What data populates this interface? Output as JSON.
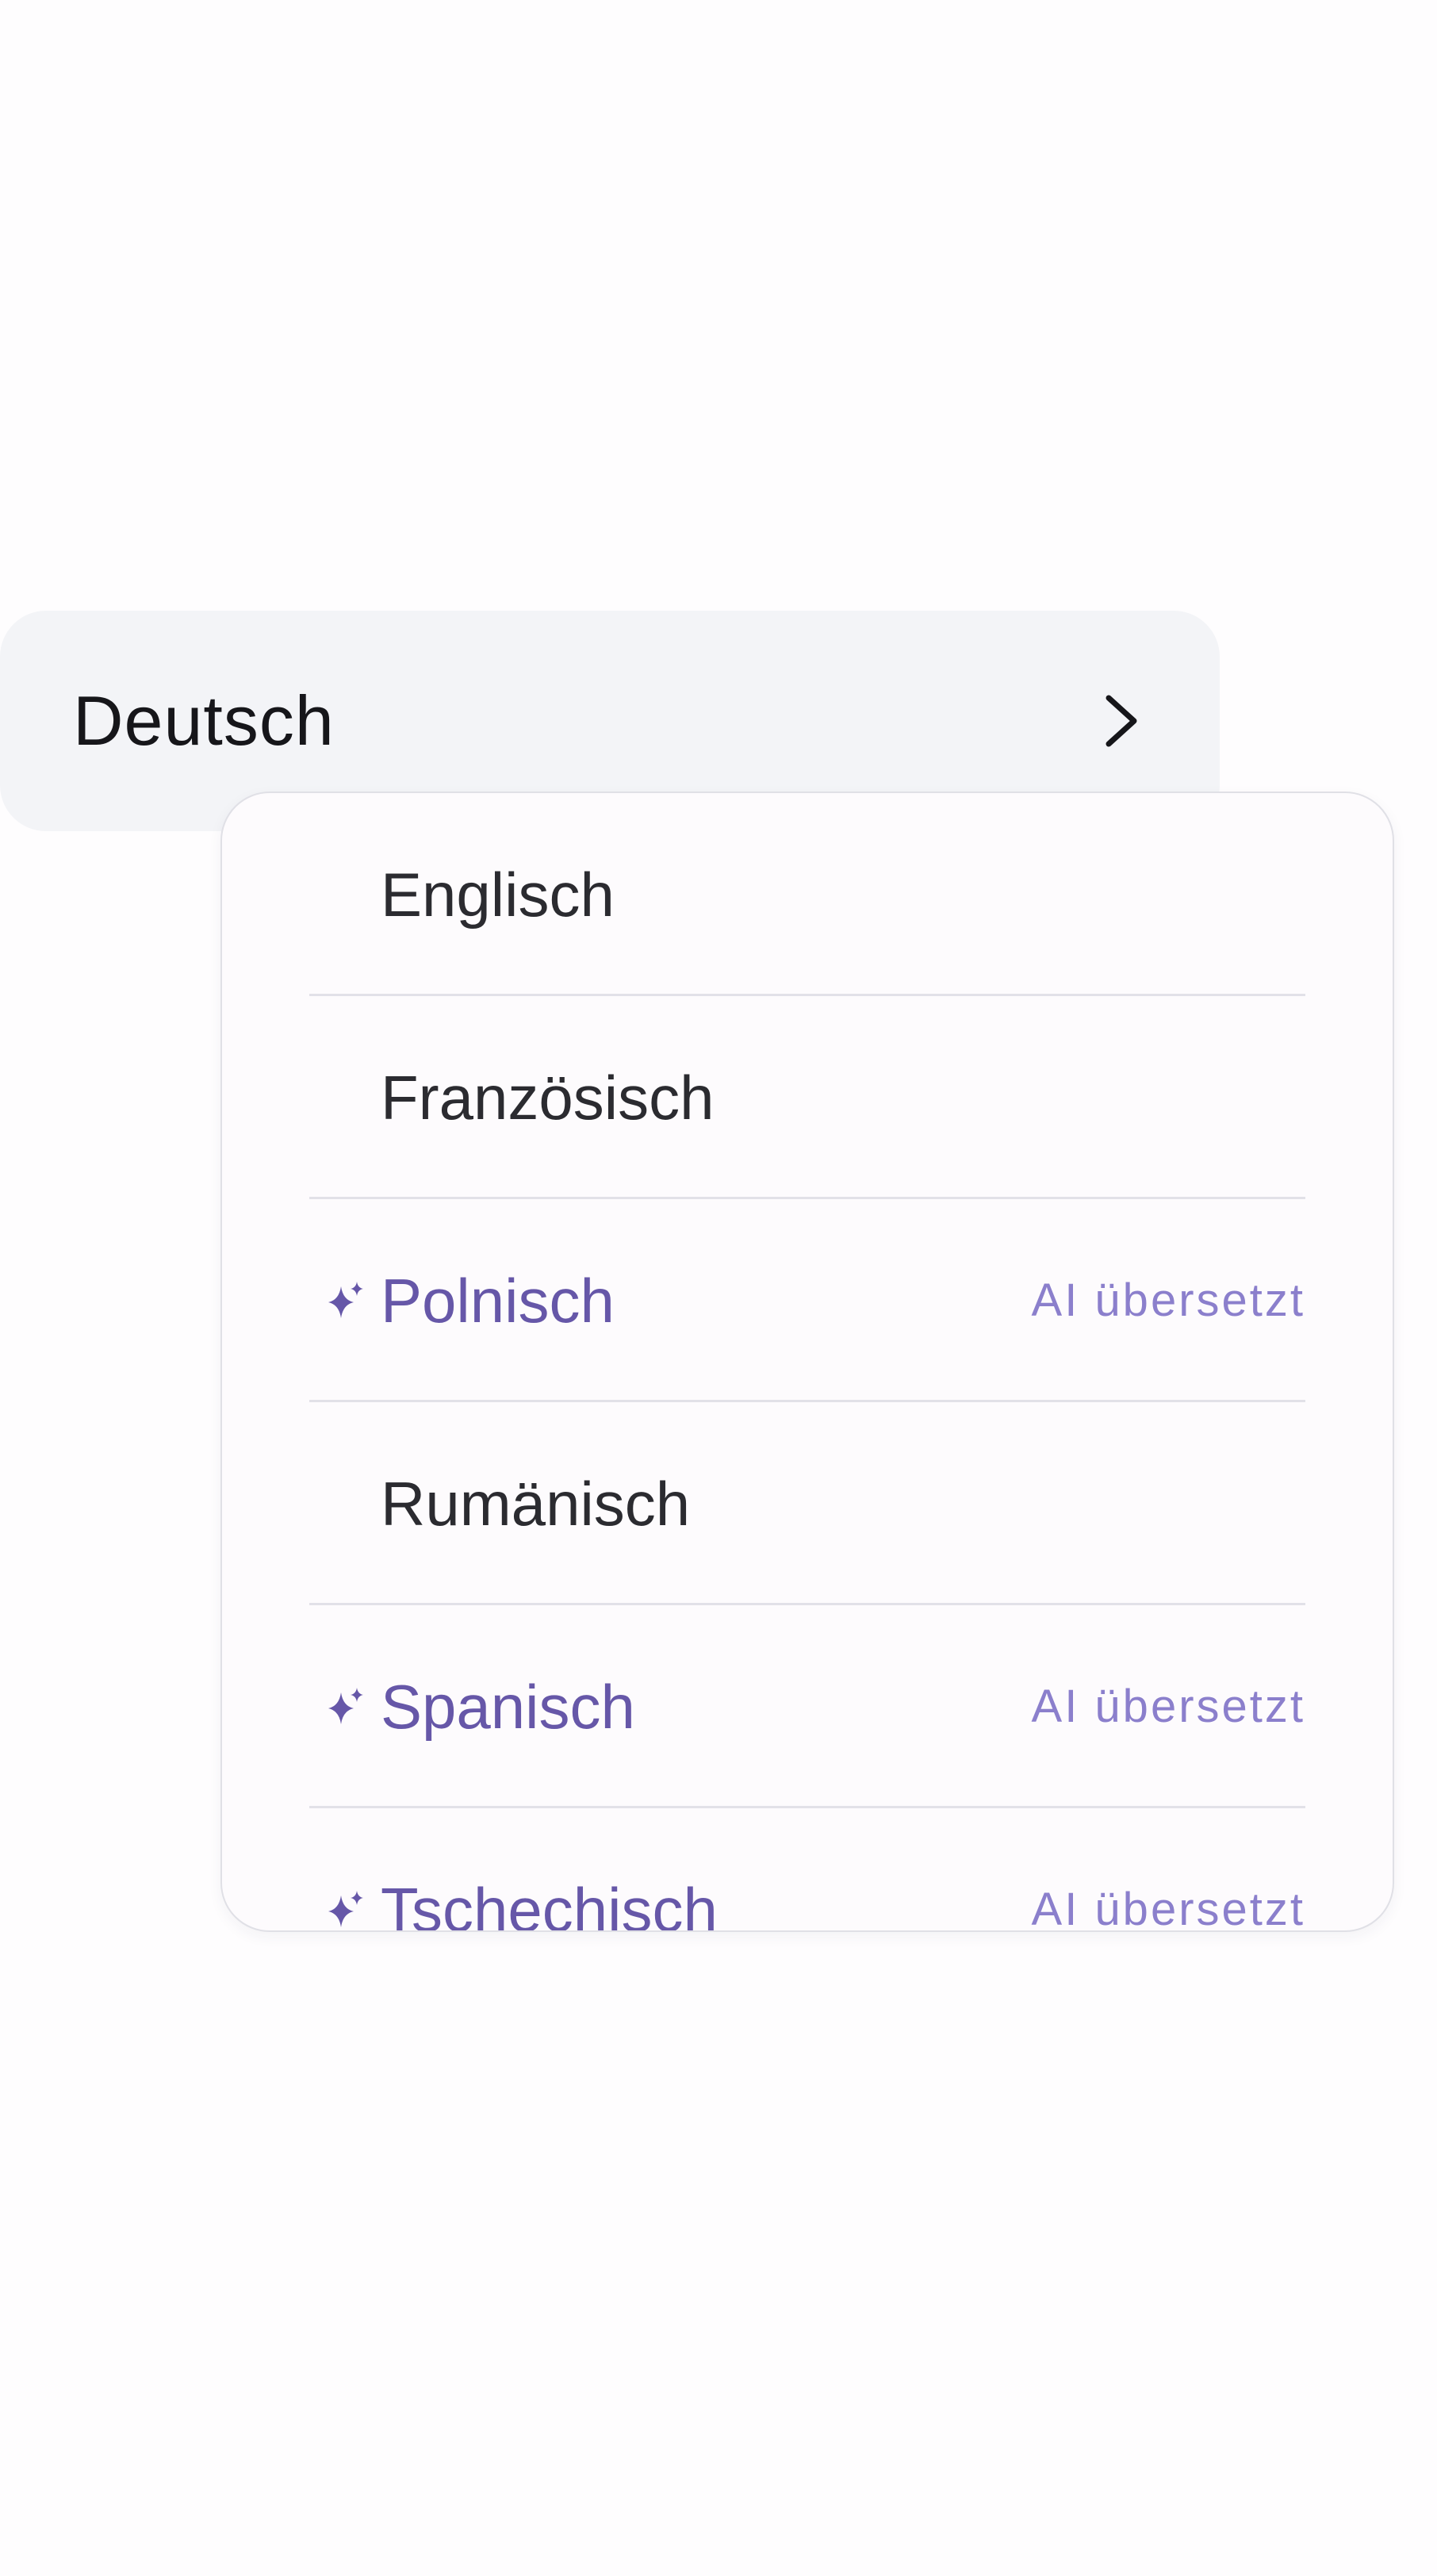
{
  "language_selector": {
    "current_language": "Deutsch",
    "icon": "chevron-right-icon"
  },
  "language_dropdown": {
    "items": [
      {
        "label": "Englisch",
        "ai_translated": false,
        "badge": ""
      },
      {
        "label": "Französisch",
        "ai_translated": false,
        "badge": ""
      },
      {
        "label": "Polnisch",
        "ai_translated": true,
        "badge": "AI übersetzt",
        "icon": "sparkle-icon"
      },
      {
        "label": "Rumänisch",
        "ai_translated": false,
        "badge": ""
      },
      {
        "label": "Spanisch",
        "ai_translated": true,
        "badge": "AI übersetzt",
        "icon": "sparkle-icon"
      },
      {
        "label": "Tschechisch",
        "ai_translated": true,
        "badge": "AI übersetzt",
        "icon": "sparkle-icon"
      }
    ]
  },
  "colors": {
    "selector_background": "#f3f4f7",
    "ai_accent": "#6657a8",
    "ai_badge": "#8b7fcc",
    "divider": "#e2e1e8"
  }
}
